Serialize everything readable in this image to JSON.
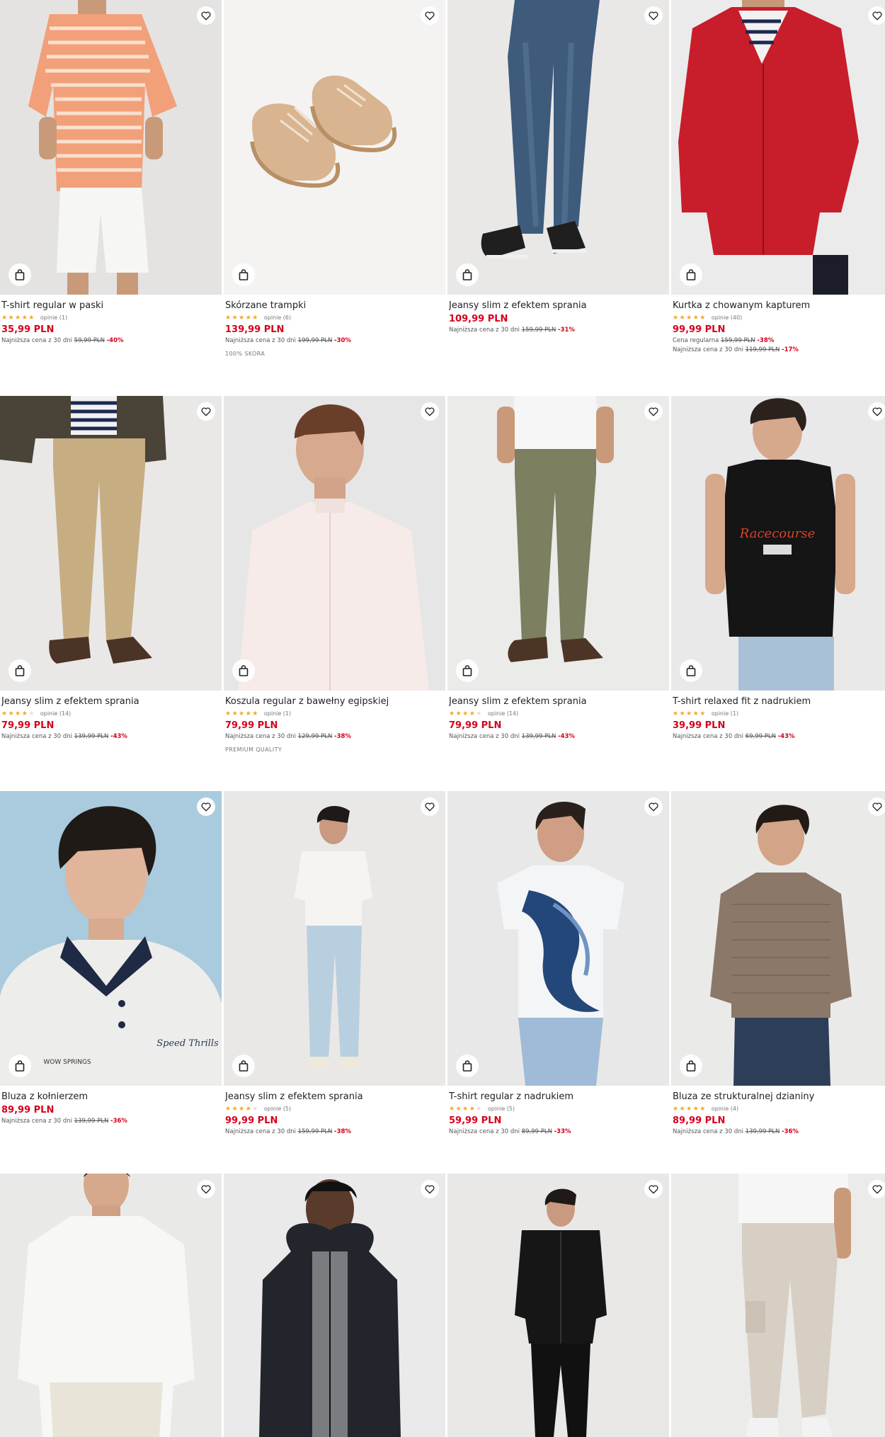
{
  "products": [
    {
      "title": "T-shirt regular w paski",
      "rating_stars": 5,
      "reviews": "opinie (1)",
      "price": "35,99 PLN",
      "lowest_label": "Najniższa cena z 30 dni",
      "lowest_old": "59,99 PLN",
      "lowest_disc": "-40%"
    },
    {
      "title": "Skórzane trampki",
      "rating_stars": 5,
      "reviews": "opinie (6)",
      "price": "139,99 PLN",
      "lowest_label": "Najniższa cena z 30 dni",
      "lowest_old": "199,99 PLN",
      "lowest_disc": "-30%",
      "tag": "100% SKÓRA"
    },
    {
      "title": "Jeansy slim z efektem sprania",
      "price": "109,99 PLN",
      "lowest_label": "Najniższa cena z 30 dni",
      "lowest_old": "159,99 PLN",
      "lowest_disc": "-31%"
    },
    {
      "title": "Kurtka z chowanym kapturem",
      "rating_stars": 5,
      "reviews": "opinie (40)",
      "price": "99,99 PLN",
      "regular_label": "Cena regularna",
      "regular_old": "159,99 PLN",
      "regular_disc": "-38%",
      "lowest_label": "Najniższa cena z 30 dni",
      "lowest_old": "119,99 PLN",
      "lowest_disc": "-17%"
    },
    {
      "title": "Jeansy slim z efektem sprania",
      "rating_stars": 4.5,
      "reviews": "opinie (14)",
      "price": "79,99 PLN",
      "lowest_label": "Najniższa cena z 30 dni",
      "lowest_old": "139,99 PLN",
      "lowest_disc": "-43%"
    },
    {
      "title": "Koszula regular z bawełny egipskiej",
      "rating_stars": 5,
      "reviews": "opinie (1)",
      "price": "79,99 PLN",
      "lowest_label": "Najniższa cena z 30 dni",
      "lowest_old": "129,99 PLN",
      "lowest_disc": "-38%",
      "tag": "PREMIUM QUALITY"
    },
    {
      "title": "Jeansy slim z efektem sprania",
      "rating_stars": 4.5,
      "reviews": "opinie (14)",
      "price": "79,99 PLN",
      "lowest_label": "Najniższa cena z 30 dni",
      "lowest_old": "139,99 PLN",
      "lowest_disc": "-43%"
    },
    {
      "title": "T-shirt relaxed fit z nadrukiem",
      "rating_stars": 5,
      "reviews": "opinie (1)",
      "price": "39,99 PLN",
      "lowest_label": "Najniższa cena z 30 dni",
      "lowest_old": "69,99 PLN",
      "lowest_disc": "-43%"
    },
    {
      "title": "Bluza z kołnierzem",
      "price": "89,99 PLN",
      "lowest_label": "Najniższa cena z 30 dni",
      "lowest_old": "139,99 PLN",
      "lowest_disc": "-36%"
    },
    {
      "title": "Jeansy slim z efektem sprania",
      "rating_stars": 4.5,
      "reviews": "opinie (5)",
      "price": "99,99 PLN",
      "lowest_label": "Najniższa cena z 30 dni",
      "lowest_old": "159,99 PLN",
      "lowest_disc": "-38%"
    },
    {
      "title": "T-shirt regular z nadrukiem",
      "rating_stars": 4,
      "reviews": "opinie (5)",
      "price": "59,99 PLN",
      "lowest_label": "Najniższa cena z 30 dni",
      "lowest_old": "89,99 PLN",
      "lowest_disc": "-33%"
    },
    {
      "title": "Bluza ze strukturalnej dzianiny",
      "rating_stars": 5,
      "reviews": "opinie (4)",
      "price": "89,99 PLN",
      "lowest_label": "Najniższa cena z 30 dni",
      "lowest_old": "139,99 PLN",
      "lowest_disc": "-36%"
    }
  ],
  "partial_row_cards": 4,
  "icons": {
    "favorite": "heart-outline-icon",
    "add_to_cart": "shopping-bag-icon"
  },
  "colors": {
    "price": "#d6001c",
    "star": "#f5a623",
    "discount": "#d6001c"
  }
}
